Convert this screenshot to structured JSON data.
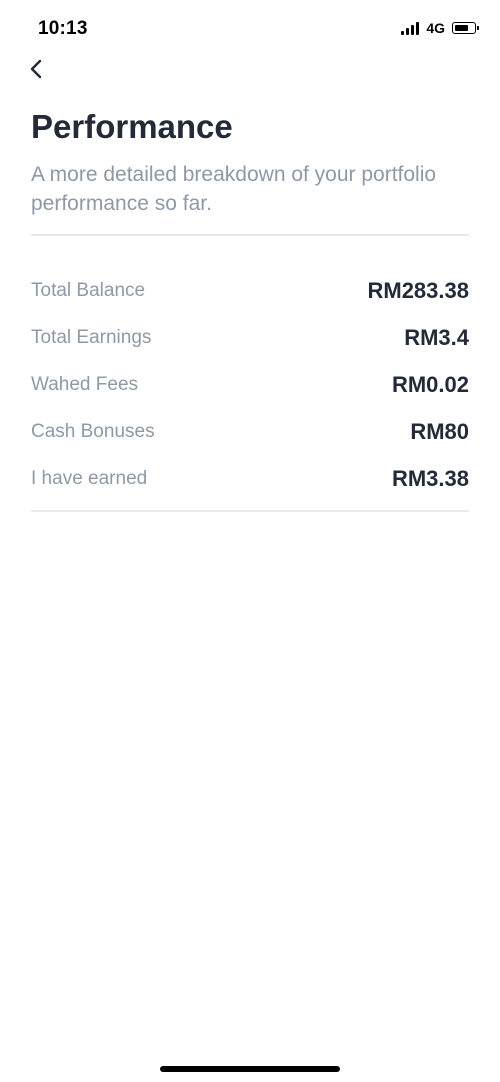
{
  "status_bar": {
    "time": "10:13",
    "network": "4G",
    "battery_level": 0.7
  },
  "header": {
    "back_icon": "chevron-left-icon",
    "title": "Performance",
    "subtitle": "A more detailed breakdown of your portfolio performance so far."
  },
  "stats": [
    {
      "label": "Total Balance",
      "value": "RM283.38"
    },
    {
      "label": "Total Earnings",
      "value": "RM3.4"
    },
    {
      "label": "Wahed Fees",
      "value": "RM0.02"
    },
    {
      "label": "Cash Bonuses",
      "value": "RM80"
    },
    {
      "label": "I have earned",
      "value": "RM3.38"
    }
  ],
  "colors": {
    "title": "#232b38",
    "muted": "#8e99a8",
    "divider": "#e6e8eb"
  }
}
